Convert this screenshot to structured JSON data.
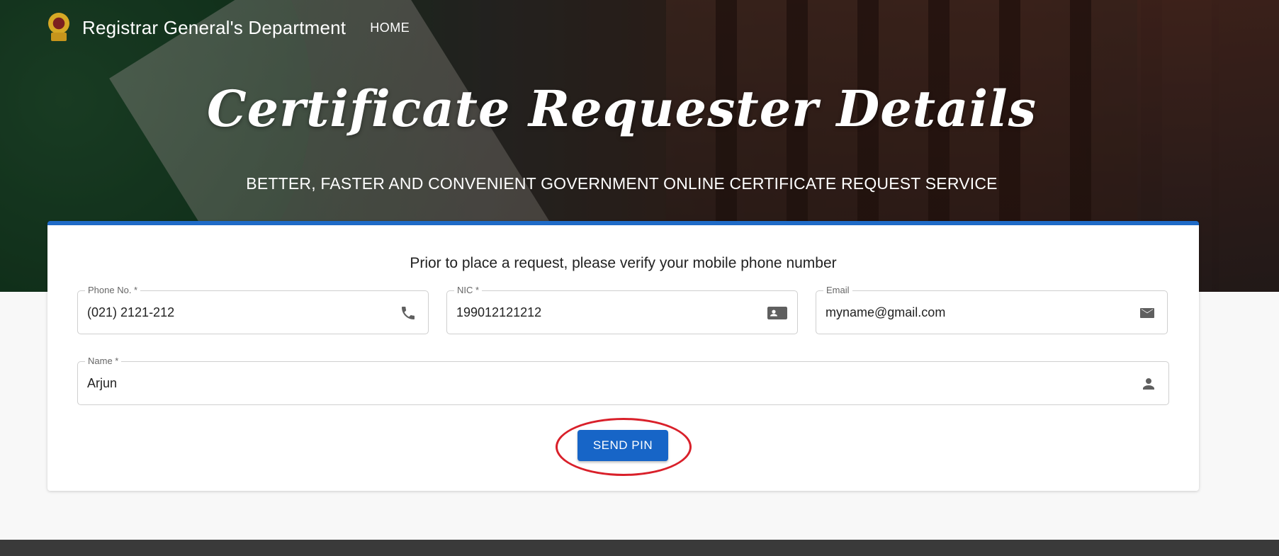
{
  "nav": {
    "brand": "Registrar General's Department",
    "home_link": "HOME"
  },
  "hero": {
    "title": "Certificate Requester Details",
    "subtitle": "BETTER, FASTER AND CONVENIENT GOVERNMENT ONLINE CERTIFICATE REQUEST SERVICE"
  },
  "form": {
    "instruction": "Prior to place a request, please verify your mobile phone number",
    "phone": {
      "label": "Phone No. *",
      "value": "(021) 2121-212",
      "icon": "phone-icon"
    },
    "nic": {
      "label": "NIC *",
      "value": "199012121212",
      "icon": "id-card-icon"
    },
    "email": {
      "label": "Email",
      "value": "myname@gmail.com",
      "icon": "mail-icon"
    },
    "name": {
      "label": "Name *",
      "value": "Arjun",
      "icon": "person-icon"
    },
    "send_button": "SEND PIN"
  },
  "colors": {
    "accent": "#1765c7",
    "highlight_ring": "#d9202a"
  }
}
